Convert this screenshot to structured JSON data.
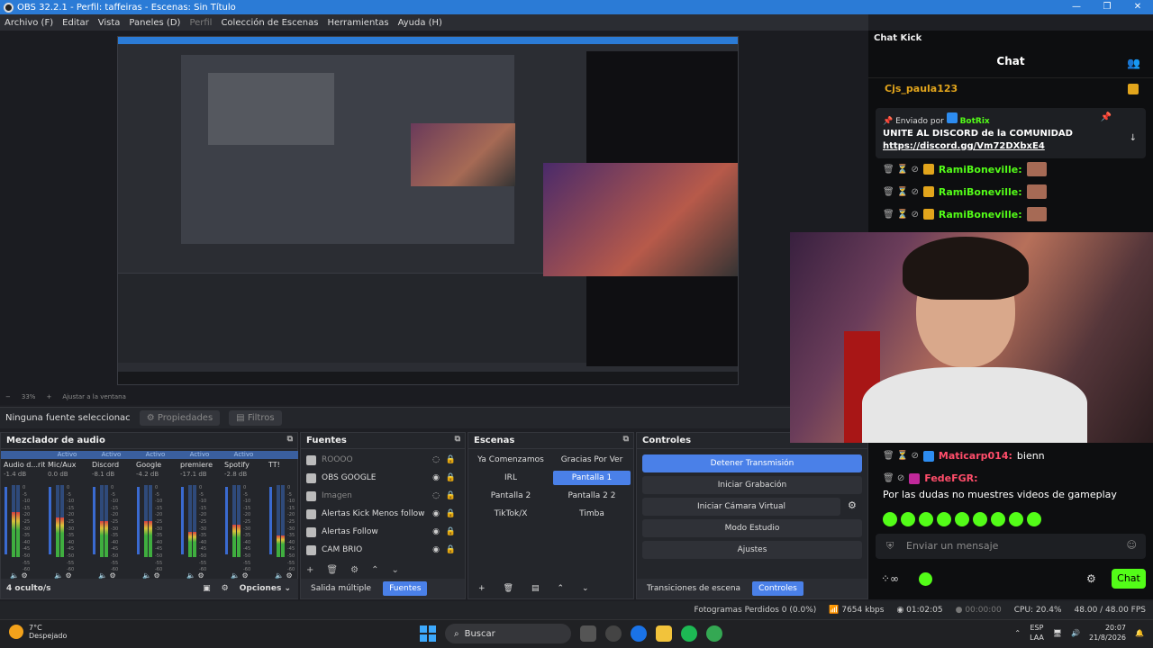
{
  "window": {
    "title": "OBS 32.2.1 - Perfil: taffeiras - Escenas: Sin Título",
    "controls": [
      "—",
      "❐",
      "✕"
    ]
  },
  "menu": {
    "items": [
      "Archivo (F)",
      "Editar",
      "Vista",
      "Paneles (D)",
      "Perfil",
      "Colección de Escenas",
      "Herramientas",
      "Ayuda (H)"
    ],
    "disabled_index": 4
  },
  "preview": {
    "zoom": "33%",
    "fit_label": "Ajustar a la ventana"
  },
  "source_toolbar": {
    "no_source": "Ninguna fuente seleccionac",
    "properties": "Propiedades",
    "filters": "Filtros"
  },
  "mixer": {
    "title": "Mezclador de audio",
    "tracks": [
      {
        "status": "",
        "name": "Audio d...ritorio",
        "db": "-1.4 dB",
        "level": 0.62,
        "color": "#2f4a7a"
      },
      {
        "status": "Activo",
        "name": "Mic/Aux",
        "db": "0.0 dB",
        "level": 0.55,
        "color": "#3a6ad0"
      },
      {
        "status": "Activo",
        "name": "Discord",
        "db": "-8.1 dB",
        "level": 0.5,
        "color": "#3a6ad0"
      },
      {
        "status": "Activo",
        "name": "Google",
        "db": "-4.2 dB",
        "level": 0.5,
        "color": "#3a6ad0"
      },
      {
        "status": "Activo",
        "name": "premiere",
        "db": "-17.1 dB",
        "level": 0.35,
        "color": "#3a6ad0"
      },
      {
        "status": "Activo",
        "name": "Spotify",
        "db": "-2.8 dB",
        "level": 0.45,
        "color": "#3a6ad0"
      },
      {
        "status": "",
        "name": "TT!",
        "db": "",
        "level": 0.3,
        "color": "#3a6ad0"
      }
    ],
    "scale": [
      "0",
      "-5",
      "-10",
      "-15",
      "-20",
      "-25",
      "-30",
      "-35",
      "-40",
      "-45",
      "-50",
      "-55",
      "-60"
    ],
    "hidden": "4 oculto/s",
    "options": "Opciones"
  },
  "sources": {
    "title": "Fuentes",
    "items": [
      {
        "name": "ROOOO",
        "dim": true
      },
      {
        "name": "OBS GOOGLE",
        "dim": false
      },
      {
        "name": "Imagen",
        "dim": true
      },
      {
        "name": "Alertas Kick Menos follow",
        "dim": false
      },
      {
        "name": "Alertas Follow",
        "dim": false
      },
      {
        "name": "CAM BRIO",
        "dim": false
      }
    ],
    "tabs": [
      "Salida múltiple",
      "Fuentes"
    ]
  },
  "scenes": {
    "title": "Escenas",
    "items": [
      "Ya Comenzamos",
      "Gracias Por Ver",
      "IRL",
      "Pantalla 1",
      "Pantalla 2",
      "Pantalla 2 2",
      "TikTok/X",
      "Timba"
    ],
    "active": "Pantalla 1"
  },
  "controls": {
    "title": "Controles",
    "buttons": [
      "Detener Transmisión",
      "Iniciar Grabación",
      "Iniciar Cámara Virtual",
      "Modo Estudio",
      "Ajustes"
    ],
    "tabs": [
      "Transiciones de escena",
      "Controles"
    ]
  },
  "chat": {
    "dock_title": "Chat Kick",
    "header": "Chat",
    "top_user": "Cjs_paula123",
    "pinned": {
      "label": "Enviado por",
      "by": "BotRix",
      "text": "UNITE AL DISCORD de la COMUNIDAD",
      "link": "https://discord.gg/Vm72DXbxE4"
    },
    "messages": [
      {
        "user": "RamiBoneville:",
        "text": ""
      },
      {
        "user": "RamiBoneville:",
        "text": ""
      },
      {
        "user": "RamiBoneville:",
        "text": ""
      }
    ],
    "msg2_user": "Maticarp014:",
    "msg2_text": "bienn",
    "msg3_user": "FedeFGR:",
    "msg3_text": "Por las dudas no muestres videos de gameplay",
    "input_placeholder": "Enviar un mensaje",
    "send": "Chat"
  },
  "status": {
    "frames": "Fotogramas Perdidos 0 (0.0%)",
    "bitrate": "7654 kbps",
    "stream_time": "01:02:05",
    "rec_time": "00:00:00",
    "cpu": "CPU: 20.4%",
    "fps": "48.00 / 48.00 FPS"
  },
  "taskbar": {
    "temp": "7°C",
    "weather": "Despejado",
    "search": "Buscar",
    "lang1": "ESP",
    "lang2": "LAA",
    "time": "20:07",
    "date": "21/8/2026"
  }
}
